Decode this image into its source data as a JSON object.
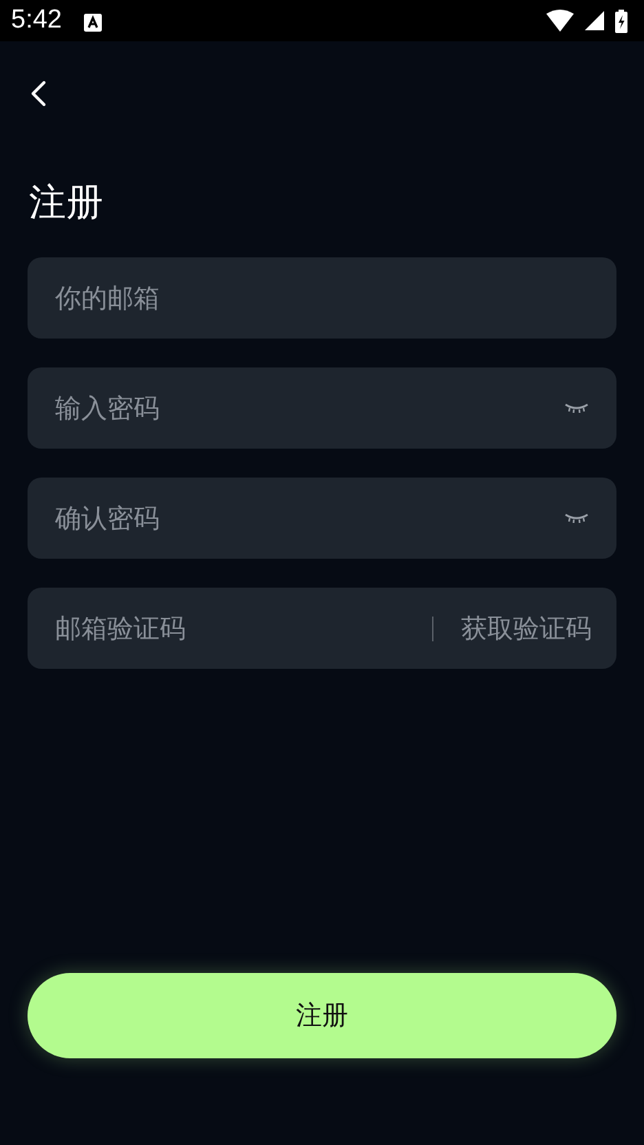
{
  "status_bar": {
    "time": "5:42"
  },
  "title": "注册",
  "fields": [
    {
      "kind": "email",
      "placeholder": "你的邮箱"
    },
    {
      "kind": "password",
      "placeholder": "输入密码"
    },
    {
      "kind": "password",
      "placeholder": "确认密码"
    },
    {
      "kind": "code",
      "placeholder": "邮箱验证码",
      "action": "获取验证码"
    }
  ],
  "submit": "注册"
}
